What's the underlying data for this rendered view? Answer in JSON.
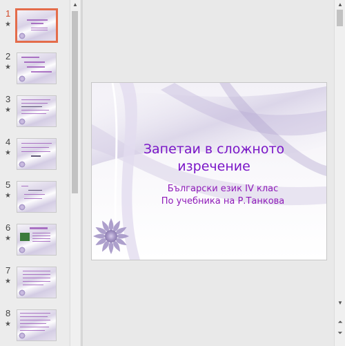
{
  "thumbnails": [
    {
      "number": "1",
      "star": "★",
      "selected": true
    },
    {
      "number": "2",
      "star": "★"
    },
    {
      "number": "3",
      "star": "★"
    },
    {
      "number": "4",
      "star": "★"
    },
    {
      "number": "5",
      "star": "★"
    },
    {
      "number": "6",
      "star": "★"
    },
    {
      "number": "7",
      "star": "★"
    },
    {
      "number": "8",
      "star": "★"
    }
  ],
  "slide": {
    "title_line1": "Запетаи в сложното",
    "title_line2": "изречение",
    "subtitle_line1": "Български език IV клас",
    "subtitle_line2": "По учебника на Р.Танкова"
  },
  "colors": {
    "title": "#7a16c7",
    "subtitle": "#8f1bb9",
    "selected_border": "#e46c4a"
  },
  "icons": {
    "star": "star-icon",
    "scroll_up": "scroll-up-arrow-icon",
    "scroll_down": "scroll-down-arrow-icon",
    "prev_slide": "previous-slide-icon",
    "next_slide": "next-slide-icon"
  }
}
